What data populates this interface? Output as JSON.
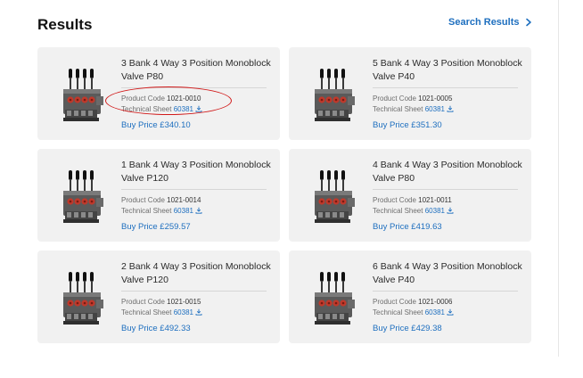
{
  "header": {
    "title": "Results",
    "search_results_link": "Search Results"
  },
  "products": [
    {
      "name": "3 Bank 4 Way 3 Position Monoblock Valve P80",
      "product_code_label": "Product Code",
      "product_code": "1021-0010",
      "technical_sheet_label": "Technical Sheet",
      "technical_sheet": "60381",
      "buy_price": "Buy Price £340.10"
    },
    {
      "name": "5 Bank 4 Way 3 Position Monoblock Valve P40",
      "product_code_label": "Product Code",
      "product_code": "1021-0005",
      "technical_sheet_label": "Technical Sheet",
      "technical_sheet": "60381",
      "buy_price": "Buy Price £351.30"
    },
    {
      "name": "1 Bank 4 Way 3 Position Monoblock Valve P120",
      "product_code_label": "Product Code",
      "product_code": "1021-0014",
      "technical_sheet_label": "Technical Sheet",
      "technical_sheet": "60381",
      "buy_price": "Buy Price £259.57"
    },
    {
      "name": "4 Bank 4 Way 3 Position Monoblock Valve P80",
      "product_code_label": "Product Code",
      "product_code": "1021-0011",
      "technical_sheet_label": "Technical Sheet",
      "technical_sheet": "60381",
      "buy_price": "Buy Price £419.63"
    },
    {
      "name": "2 Bank 4 Way 3 Position Monoblock Valve P120",
      "product_code_label": "Product Code",
      "product_code": "1021-0015",
      "technical_sheet_label": "Technical Sheet",
      "technical_sheet": "60381",
      "buy_price": "Buy Price £492.33"
    },
    {
      "name": "6 Bank 4 Way 3 Position Monoblock Valve P40",
      "product_code_label": "Product Code",
      "product_code": "1021-0006",
      "technical_sheet_label": "Technical Sheet",
      "technical_sheet": "60381",
      "buy_price": "Buy Price £429.38"
    }
  ],
  "icons": {
    "search_results_arrow": "chevron-right-icon",
    "technical_sheet": "download-icon",
    "product_image": "valve-image"
  },
  "colors": {
    "link_blue": "#1e6fbf",
    "card_background": "#f1f1f1",
    "annotation_red": "#d11a1a"
  }
}
